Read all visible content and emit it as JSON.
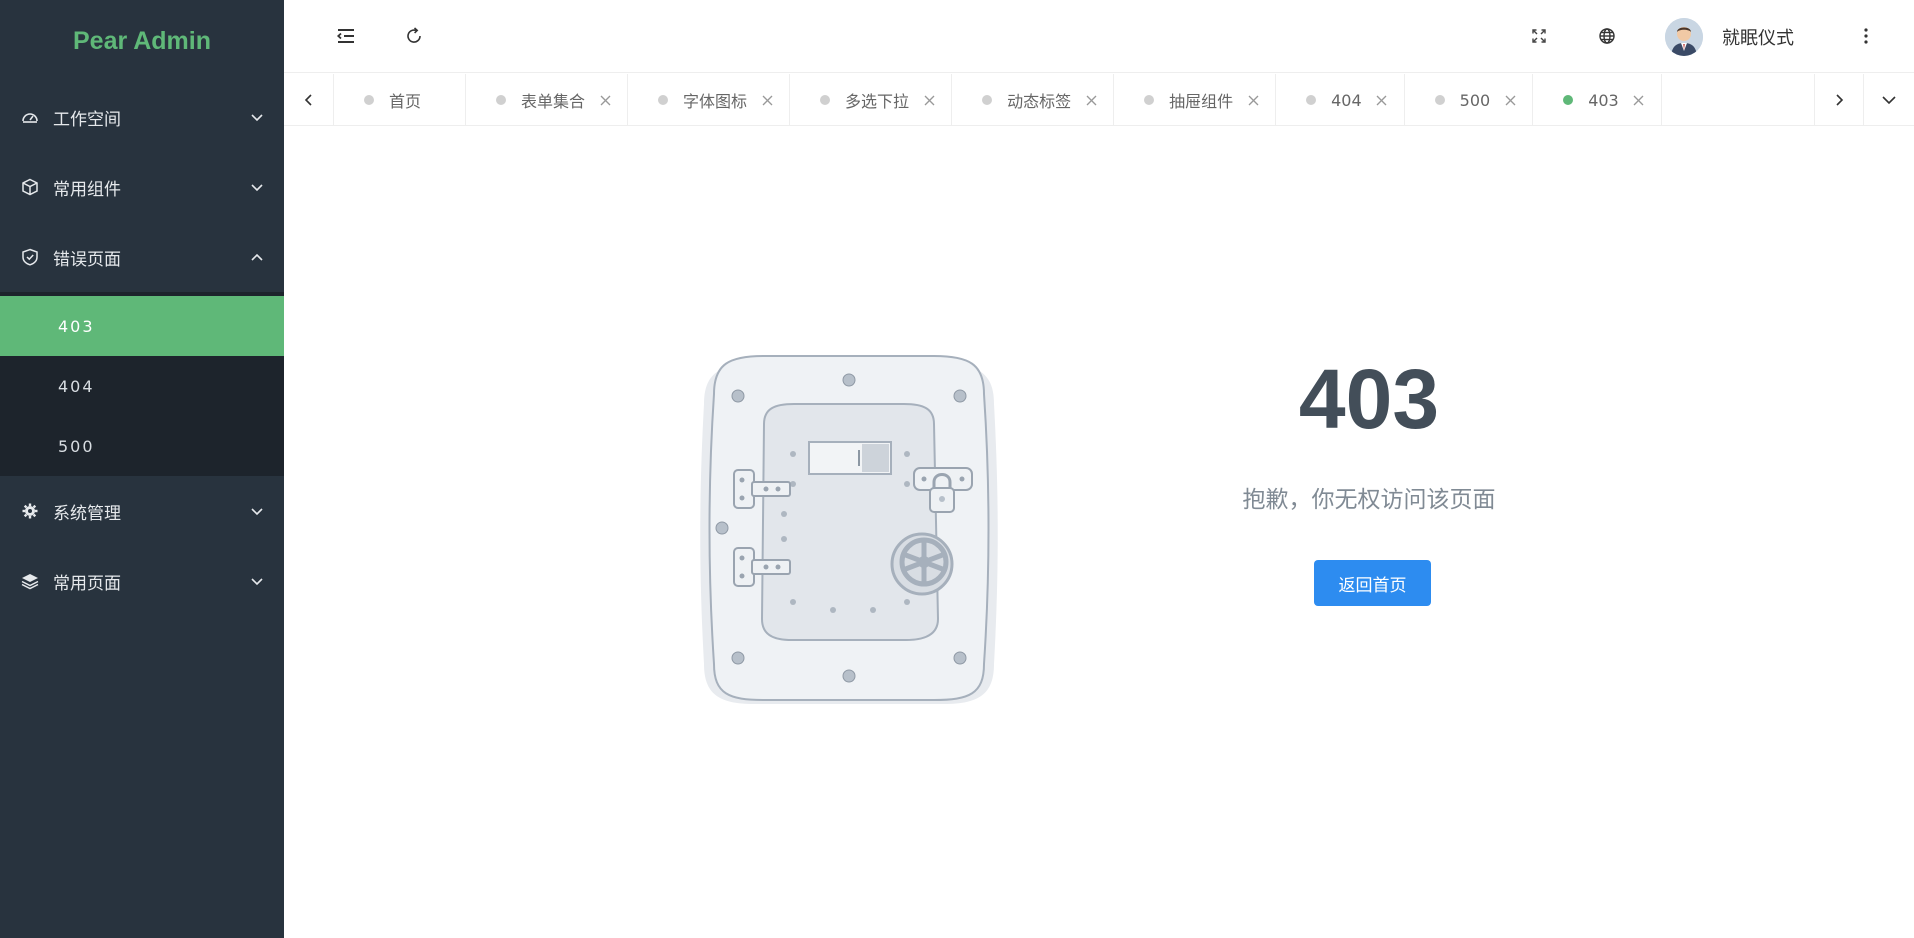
{
  "app": {
    "logo": "Pear Admin"
  },
  "sidebar": {
    "menus": [
      {
        "label": "工作空间",
        "icon": "dashboard-icon",
        "expanded": false
      },
      {
        "label": "常用组件",
        "icon": "cube-icon",
        "expanded": false
      },
      {
        "label": "错误页面",
        "icon": "shield-icon",
        "expanded": true,
        "children": [
          {
            "label": "403",
            "active": true
          },
          {
            "label": "404",
            "active": false
          },
          {
            "label": "500",
            "active": false
          }
        ]
      },
      {
        "label": "系统管理",
        "icon": "gear-icon",
        "expanded": false
      },
      {
        "label": "常用页面",
        "icon": "layers-icon",
        "expanded": false
      }
    ]
  },
  "header": {
    "left_icons": [
      "menu-collapse-icon",
      "refresh-icon"
    ],
    "right_icons": [
      "fullscreen-icon",
      "globe-icon",
      "more-vertical-icon"
    ],
    "username": "就眠仪式"
  },
  "tabs": {
    "items": [
      {
        "label": "首页",
        "closable": false,
        "active": false
      },
      {
        "label": "表单集合",
        "closable": true,
        "active": false
      },
      {
        "label": "字体图标",
        "closable": true,
        "active": false
      },
      {
        "label": "多选下拉",
        "closable": true,
        "active": false
      },
      {
        "label": "动态标签",
        "closable": true,
        "active": false
      },
      {
        "label": "抽屉组件",
        "closable": true,
        "active": false
      },
      {
        "label": "404",
        "closable": true,
        "active": false
      },
      {
        "label": "500",
        "closable": true,
        "active": false
      },
      {
        "label": "403",
        "closable": true,
        "active": true
      }
    ]
  },
  "error": {
    "code": "403",
    "description": "抱歉，你无权访问该页面",
    "button_label": "返回首页"
  },
  "colors": {
    "sidebar_bg": "#28333e",
    "submenu_bg": "#1d242c",
    "accent": "#5fb878",
    "button": "#2d8cf0",
    "error_code": "#434e59"
  }
}
